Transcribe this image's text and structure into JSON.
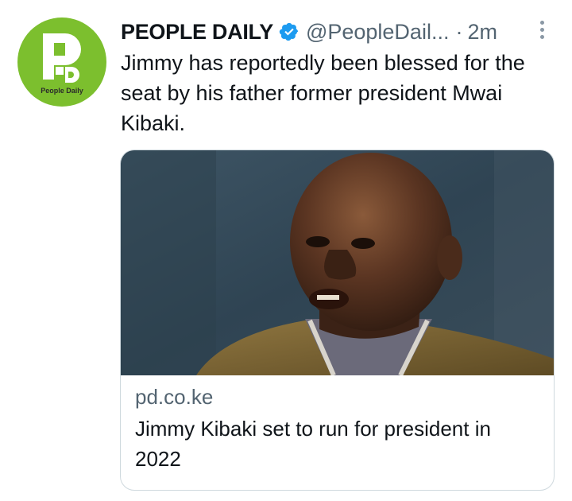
{
  "account": {
    "display_name": "PEOPLE DAILY",
    "handle": "@PeopleDail...",
    "separator": "·",
    "time": "2m",
    "verified_icon": "verified-badge-icon",
    "avatar": {
      "logo_text": "PD",
      "caption": "People Daily",
      "color": "#7cbf2e"
    }
  },
  "tweet": {
    "text": "Jimmy has reportedly been blessed for the seat by his father former president Mwai Kibaki."
  },
  "card": {
    "domain": "pd.co.ke",
    "title": "Jimmy Kibaki set to run for president in 2022",
    "image": "photo of a bald man in a brown jacket speaking"
  },
  "colors": {
    "text_primary": "#0f1419",
    "text_secondary": "#536471",
    "verified_blue": "#1d9bf0",
    "card_border": "#cfd9de"
  }
}
